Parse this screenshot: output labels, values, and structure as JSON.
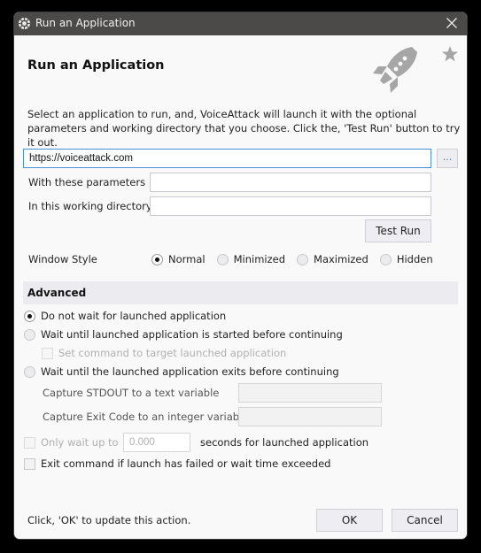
{
  "window": {
    "title": "Run an Application",
    "close_icon": "close-x-icon",
    "app_icon": "voiceattack-logo-icon"
  },
  "header": {
    "heading": "Run an Application",
    "decor_icon": "rocket-icon",
    "favorite_icon": "star-icon",
    "description": "Select an application to run, and, VoiceAttack will launch it with the optional parameters and working directory that you choose.  Click the, 'Test Run' button to try it out."
  },
  "form": {
    "application_path": "https://voiceattack.com",
    "browse_label": "...",
    "parameters_label": "With these parameters",
    "parameters_value": "",
    "working_dir_label": "In this working directory",
    "working_dir_value": "",
    "test_run_label": "Test Run"
  },
  "window_style": {
    "label": "Window Style",
    "options": [
      {
        "label": "Normal",
        "checked": true
      },
      {
        "label": "Minimized",
        "checked": false
      },
      {
        "label": "Maximized",
        "checked": false
      },
      {
        "label": "Hidden",
        "checked": false
      }
    ]
  },
  "advanced": {
    "title": "Advanced",
    "wait_options": [
      {
        "label": "Do not wait for launched application",
        "checked": true
      },
      {
        "label": "Wait until launched application is started before continuing",
        "checked": false
      },
      {
        "label": "Wait until the launched application exits before continuing",
        "checked": false
      }
    ],
    "set_target_label": "Set command to target launched application",
    "set_target_checked": false,
    "stdout_label": "Capture STDOUT to a text variable",
    "stdout_value": "",
    "exit_code_label": "Capture Exit Code to an integer variable",
    "exit_code_value": "",
    "only_wait_label": "Only wait up to",
    "only_wait_value": "0.000",
    "only_wait_suffix": "seconds for launched application",
    "only_wait_checked": false,
    "exit_on_fail_label": "Exit command if launch has failed or wait time exceeded",
    "exit_on_fail_checked": false
  },
  "footer": {
    "hint": "Click, 'OK' to update this action.",
    "ok_label": "OK",
    "cancel_label": "Cancel"
  }
}
